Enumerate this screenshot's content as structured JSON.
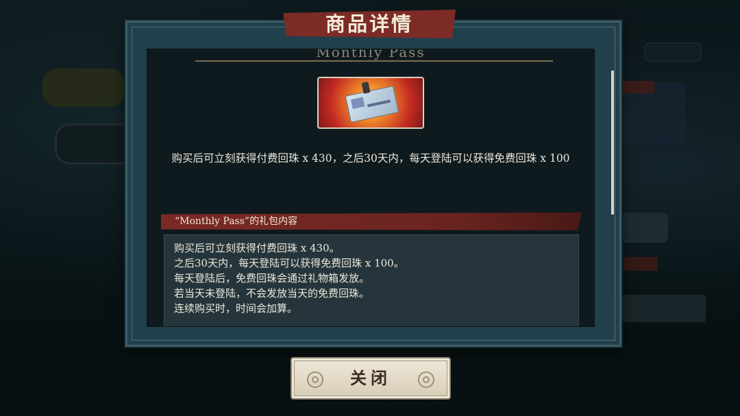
{
  "dialog": {
    "title": "商品详情",
    "subtitle": "Monthly Pass",
    "description": "购买后可立刻获得付费回珠 x 430，之后30天内，每天登陆可以获得免费回珠 x 100",
    "section_header": "“Monthly Pass”的礼包内容",
    "details": [
      "购买后可立刻获得付费回珠 x 430。",
      "之后30天内，每天登陆可以获得免费回珠 x 100。",
      "每天登陆后，免费回珠会通过礼物箱发放。",
      "若当天未登陆，不会发放当天的免费回珠。",
      "连续购买时，时间会加算。"
    ],
    "close_label": "关闭"
  },
  "icons": {
    "item_image": "monthly-pass-card-icon"
  },
  "colors": {
    "banner_red": "#7c2b26",
    "frame_teal": "#22404c",
    "panel_dark": "#0f1a1e",
    "button_cream": "#efe8d8"
  }
}
